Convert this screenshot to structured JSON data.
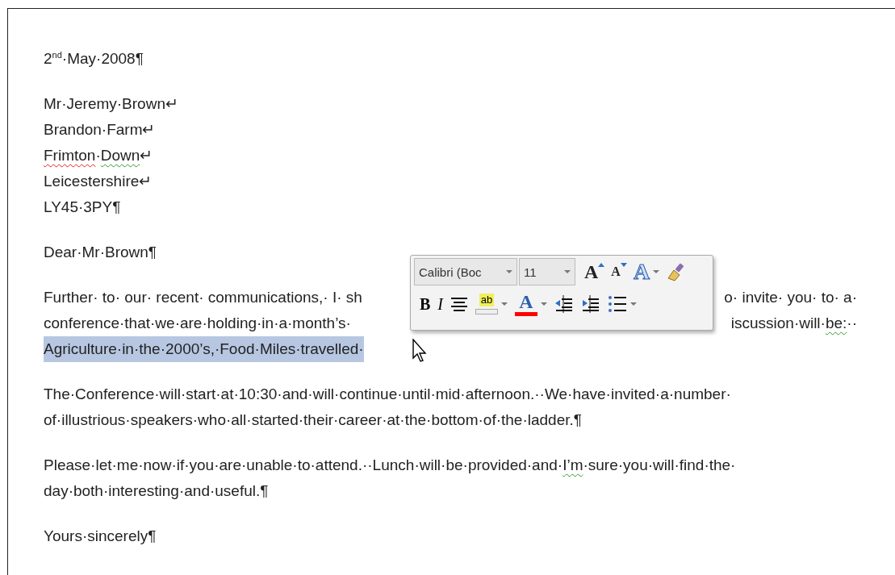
{
  "document": {
    "paragraphs": [
      {
        "lines": [
          {
            "parts": [
              [
                {
                  "text": "2$^{nd}$·May·2008¶"
                }
              ]
            ]
          }
        ]
      },
      {
        "lines": [
          {
            "parts": [
              [
                {
                  "text": "Mr·Jeremy·Brown↵"
                }
              ]
            ]
          },
          {
            "parts": [
              [
                {
                  "text": "Brandon·Farm↵"
                }
              ]
            ]
          },
          {
            "parts": [
              [
                {
                  "text": "Frimton",
                  "misspelled": true
                },
                {
                  "text": "·"
                },
                {
                  "text": "Down",
                  "grammar_flag": true
                },
                {
                  "text": "↵"
                }
              ]
            ]
          },
          {
            "parts": [
              [
                {
                  "text": "Leicestershire↵"
                }
              ]
            ]
          },
          {
            "parts": [
              [
                {
                  "text": "LY45·3PY¶"
                }
              ]
            ]
          }
        ]
      },
      {
        "lines": [
          {
            "parts": [
              [
                {
                  "text": "Dear·Mr·Brown¶"
                }
              ]
            ]
          }
        ]
      },
      {
        "lines": [
          {
            "parts": [
              [
                {
                  "text": "Further· to· our· recent· communications,· I· sh"
                }
              ],
              [
                {
                  "text": "o· invite· you· to· a·"
                }
              ]
            ]
          },
          {
            "parts": [
              [
                {
                  "text": "conference·that·we·are·holding·in·a·month’s·"
                }
              ],
              [
                {
                  "text": "iscussion·will·"
                },
                {
                  "text": "be:",
                  "grammar_flag": true
                },
                {
                  "text": "··"
                }
              ]
            ]
          },
          {
            "selected": true,
            "parts": [
              [
                {
                  "text": "Agriculture·in·the·2000’s,·Food·Miles·travelled·"
                }
              ]
            ]
          }
        ]
      },
      {
        "lines": [
          {
            "parts": [
              [
                {
                  "text": "The·Conference·will·start·at·10:30·and·will·continue·until·mid·afternoon.··We·have·invited·a·number·"
                }
              ]
            ]
          },
          {
            "parts": [
              [
                {
                  "text": "of·illustrious·speakers·who·all·started·their·career·at·the·bottom·of·the·ladder.¶"
                }
              ]
            ]
          }
        ]
      },
      {
        "lines": [
          {
            "parts": [
              [
                {
                  "text": "Please·let·me·now·if·you·are·unable·to·attend.··Lunch·will·be·provided·and·"
                },
                {
                  "text": "I’m",
                  "grammar_flag": true
                },
                {
                  "text": "·sure·you·will·find·the·"
                }
              ]
            ]
          },
          {
            "parts": [
              [
                {
                  "text": "day·both·interesting·and·useful.¶"
                }
              ]
            ]
          }
        ]
      },
      {
        "lines": [
          {
            "parts": [
              [
                {
                  "text": "Yours·sincerely¶"
                }
              ]
            ]
          }
        ]
      }
    ]
  },
  "mini_toolbar": {
    "font_name": "Calibri (Boc",
    "font_size": "11",
    "rows": [
      [
        {
          "kind": "grow-font",
          "label": "A"
        },
        {
          "kind": "shrink-font",
          "label": "A"
        },
        {
          "kind": "text-effects",
          "label": "A",
          "dropdown": true
        },
        {
          "kind": "format-painter"
        }
      ],
      [
        {
          "kind": "bold",
          "label": "B"
        },
        {
          "kind": "italic",
          "label": "I"
        },
        {
          "kind": "center"
        },
        {
          "kind": "highlight",
          "label": "ab",
          "dropdown": true
        },
        {
          "kind": "font-color",
          "label": "A",
          "color": "#ff0000",
          "dropdown": true
        },
        {
          "kind": "decrease-indent"
        },
        {
          "kind": "increase-indent"
        },
        {
          "kind": "bullets",
          "dropdown": true
        }
      ]
    ]
  }
}
